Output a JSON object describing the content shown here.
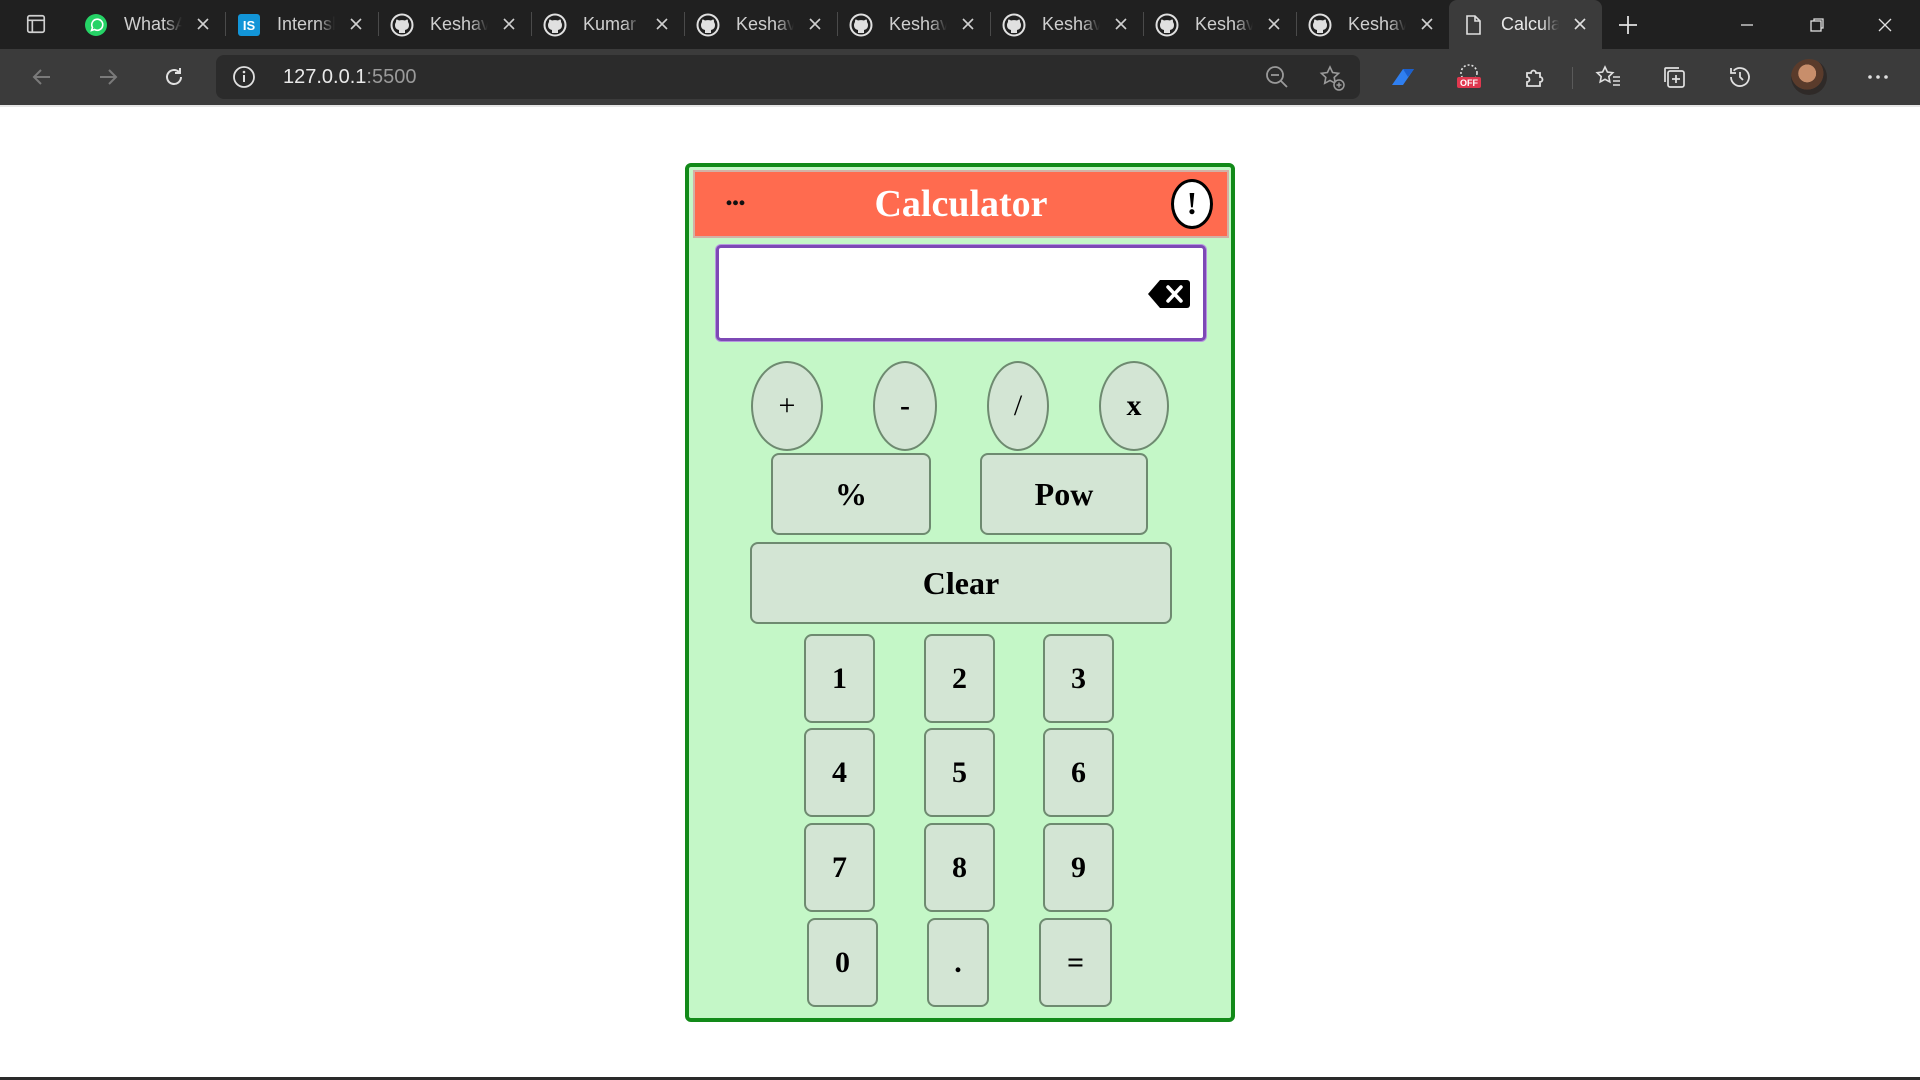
{
  "browser": {
    "tabs": [
      {
        "label": "WhatsApp",
        "icon": "whatsapp-icon"
      },
      {
        "label": "Internshala",
        "icon": "internshala-icon"
      },
      {
        "label": "Keshav",
        "icon": "github-icon"
      },
      {
        "label": "Kumar",
        "icon": "github-icon"
      },
      {
        "label": "Keshav",
        "icon": "github-icon"
      },
      {
        "label": "Keshav",
        "icon": "github-icon"
      },
      {
        "label": "Keshav",
        "icon": "github-icon"
      },
      {
        "label": "Keshav",
        "icon": "github-icon"
      },
      {
        "label": "Keshav",
        "icon": "github-icon"
      },
      {
        "label": "Calculator",
        "icon": "page-icon",
        "active": true
      }
    ],
    "address": {
      "host": "127.0.0.1",
      "port": ":5500"
    }
  },
  "calculator": {
    "title": "Calculator",
    "menu_label": "...",
    "info_label": "!",
    "display_value": "",
    "operators": [
      "+",
      "-",
      "/",
      "x"
    ],
    "percent_label": "%",
    "pow_label": "Pow",
    "clear_label": "Clear",
    "digits": {
      "d1": "1",
      "d2": "2",
      "d3": "3",
      "d4": "4",
      "d5": "5",
      "d6": "6",
      "d7": "7",
      "d8": "8",
      "d9": "9",
      "d0": "0"
    },
    "dot_label": ".",
    "equals_label": "=",
    "colors": {
      "header": "#ff6b4f",
      "body": "#c4f7c7",
      "border": "#128a19",
      "button": "#d3e5d4",
      "display_border": "#7d49b5"
    }
  }
}
